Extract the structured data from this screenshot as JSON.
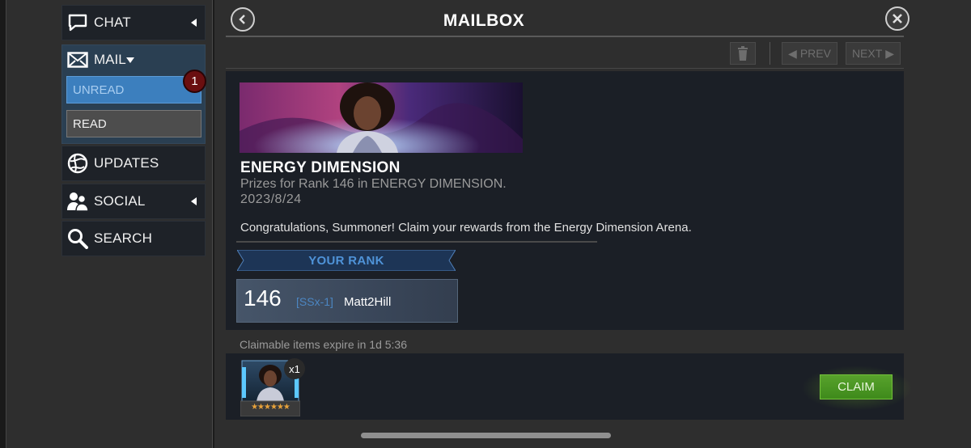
{
  "sidebar": {
    "chat": {
      "label": "CHAT"
    },
    "mail": {
      "label": "MAIL",
      "unread_label": "UNREAD",
      "read_label": "READ",
      "unread_count": "1"
    },
    "updates": {
      "label": "UPDATES"
    },
    "social": {
      "label": "SOCIAL"
    },
    "search": {
      "label": "SEARCH"
    }
  },
  "header": {
    "title": "MAILBOX"
  },
  "toolbar": {
    "prev_label": "PREV",
    "next_label": "NEXT"
  },
  "message": {
    "title": "ENERGY DIMENSION",
    "subtitle": "Prizes for Rank 146 in ENERGY DIMENSION.",
    "date": "2023/8/24",
    "body": "Congratulations, Summoner! Claim your rewards from the Energy Dimension Arena.",
    "rank_heading": "YOUR RANK",
    "rank_number": "146",
    "rank_tag": "[SSx-1]",
    "rank_name": "Matt2Hill"
  },
  "rewards": {
    "expire_text": "Claimable items expire in 1d 5:36",
    "item_qty": "x1",
    "item_stars": "★★★★★★",
    "claim_label": "CLAIM"
  },
  "colors": {
    "accent_blue": "#3c7fbe",
    "claim_green": "#4a9624",
    "badge_red": "#6a0f10"
  }
}
